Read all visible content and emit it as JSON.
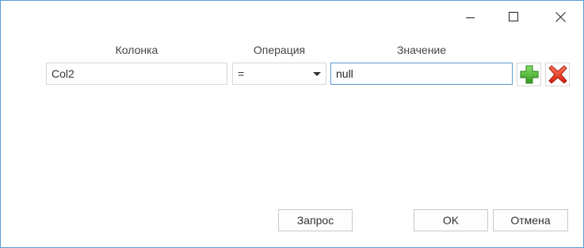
{
  "window": {
    "controls": {
      "minimize_icon": "minimize-icon",
      "maximize_icon": "maximize-icon",
      "close_icon": "close-icon"
    }
  },
  "filter": {
    "headers": {
      "column": "Колонка",
      "operation": "Операция",
      "value": "Значение"
    },
    "row": {
      "column_value": "Col2",
      "operation_value": "=",
      "value_value": "null"
    },
    "row_actions": {
      "add_icon": "plus-icon",
      "add_color": "#3fae29",
      "remove_icon": "delete-x-icon",
      "remove_color": "#e0301e"
    }
  },
  "footer": {
    "query_label": "Запрос",
    "ok_label": "OK",
    "cancel_label": "Отмена"
  },
  "colors": {
    "focus_border": "#5b9bd5",
    "field_border": "#d7d7d7"
  }
}
